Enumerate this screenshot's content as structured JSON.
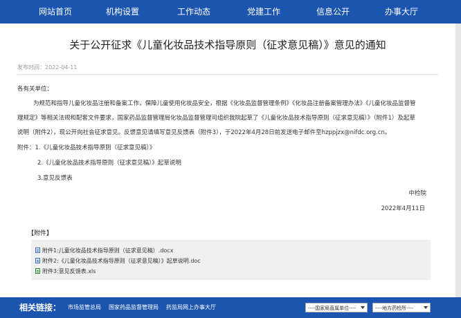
{
  "nav": {
    "items": [
      "网站首页",
      "机构设置",
      "工作动态",
      "党建工作",
      "信息公开",
      "办事大厅"
    ]
  },
  "article": {
    "title": "关于公开征求《儿童化妆品技术指导原则（征求意见稿）》意见的通知",
    "date": "发布时间：2022-04-11",
    "salutation": "各有关单位：",
    "para_line1": "为规范和指导儿童化妆品注册和备案工作，保障儿童使用化妆品安全，根据《化妆品监督管理条例》《化妆品注册备案管理办法》《儿童化妆品监督管",
    "para_line2": "理规定》等相关法规和配套文件要求，国家药品监督管理局化妆品监督管理司组织我院起草了《儿童化妆品技术指导原则（征求意见稿）》（附件1）及起草",
    "para_line3": "说明（附件2），现公开向社会征求意见。反馈意见请填写意见反馈表（附件3），于2022年4月28日前发送电子邮件至hzppjzx@nifdc.org.cn。",
    "attach_list": [
      "附件：1.《儿童化妆品技术指导原则（征求意见稿）》",
      "2.《儿童化妆品技术指导原则（征求意见稿）》起草说明",
      "3.意见反馈表"
    ],
    "signature_org": "中检院",
    "signature_date": "2022年4月11日"
  },
  "attachments": {
    "heading": "【附件】",
    "files": [
      {
        "label": "附件1:儿童化妆品技术指导原则（征求意见稿）.docx",
        "icon": "word-file-icon"
      },
      {
        "label": "附件2:《儿童化妆品技术指导原则（征求意见稿）》起草说明.doc",
        "icon": "word-file-icon"
      },
      {
        "label": "附件3:意见反馈表.xls",
        "icon": "excel-file-icon"
      }
    ]
  },
  "footer": {
    "title": "相关链接：",
    "links": [
      "市场监管总局",
      "国家药品监督管理局",
      "药监局网上办事大厅"
    ],
    "selects": [
      "----国家局直属单位----",
      "----地方药检所----"
    ]
  },
  "colors": {
    "primary": "#1b55b0"
  }
}
